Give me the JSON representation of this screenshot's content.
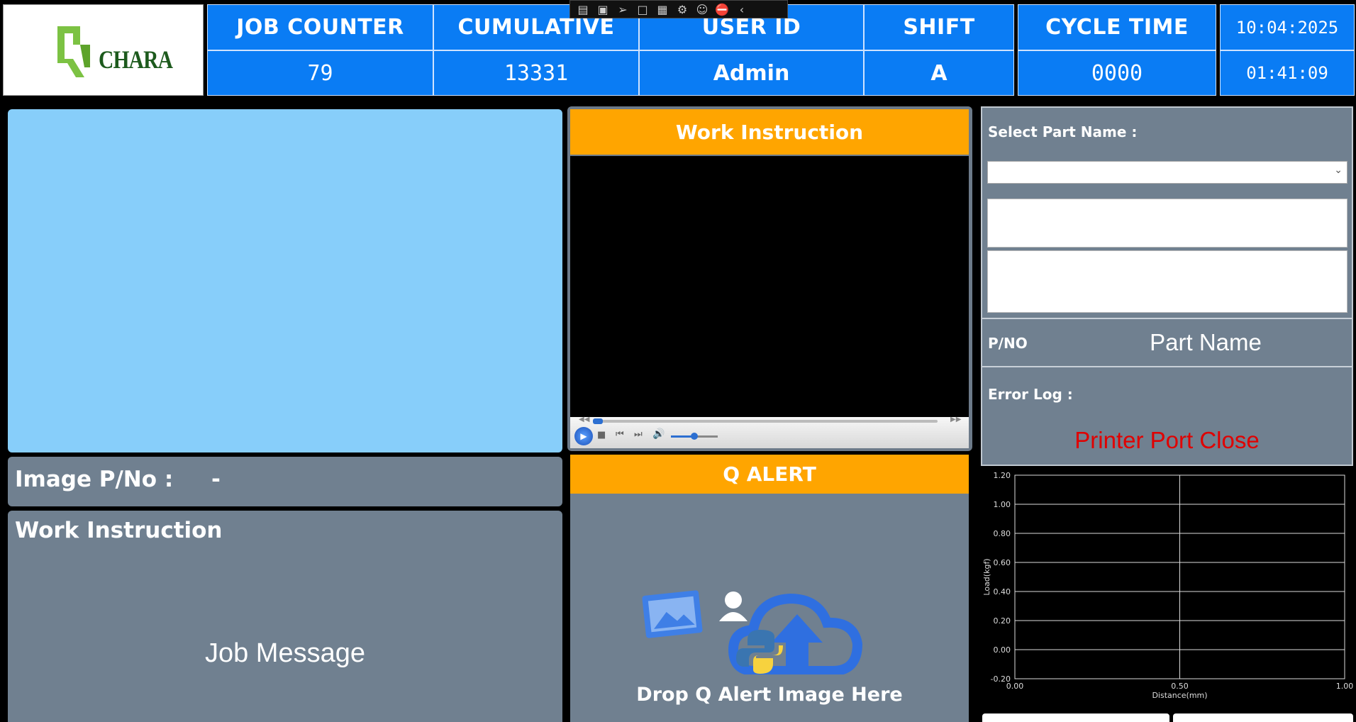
{
  "header": {
    "logo_text": "CHARA",
    "job_counter": {
      "label": "JOB COUNTER",
      "value": "79"
    },
    "cumulative": {
      "label": "CUMULATIVE",
      "value": "13331"
    },
    "user_id": {
      "label": "USER ID",
      "value": "Admin"
    },
    "shift": {
      "label": "SHIFT",
      "value": "A"
    },
    "cycle_time": {
      "label": "CYCLE TIME",
      "value": "0000"
    },
    "date": "10:04:2025",
    "time": "01:41:09"
  },
  "left": {
    "image_pno_label": "Image P/No :",
    "image_pno_value": "-",
    "work_instruction_title": "Work Instruction",
    "job_message": "Job Message"
  },
  "center": {
    "work_instruction_header": "Work Instruction",
    "q_alert_header": "Q ALERT",
    "drop_text": "Drop Q Alert Image Here"
  },
  "right": {
    "select_part_label": "Select Part Name :",
    "pno_label": "P/NO",
    "part_name": "Part Name",
    "error_log_label": "Error Log :",
    "error_message": "Printer Port Close",
    "error_color": "#e00000"
  },
  "chart_data": {
    "type": "line",
    "xlabel": "Distance(mm)",
    "ylabel": "Load(kgf)",
    "xlim": [
      0,
      1
    ],
    "ylim": [
      -0.2,
      1.2
    ],
    "xticks": [
      "0.00",
      "0.50",
      "1.00"
    ],
    "yticks": [
      "1.20",
      "1.00",
      "0.80",
      "0.60",
      "0.40",
      "0.20",
      "0.00",
      "-0.20"
    ],
    "grid": true,
    "series": []
  }
}
